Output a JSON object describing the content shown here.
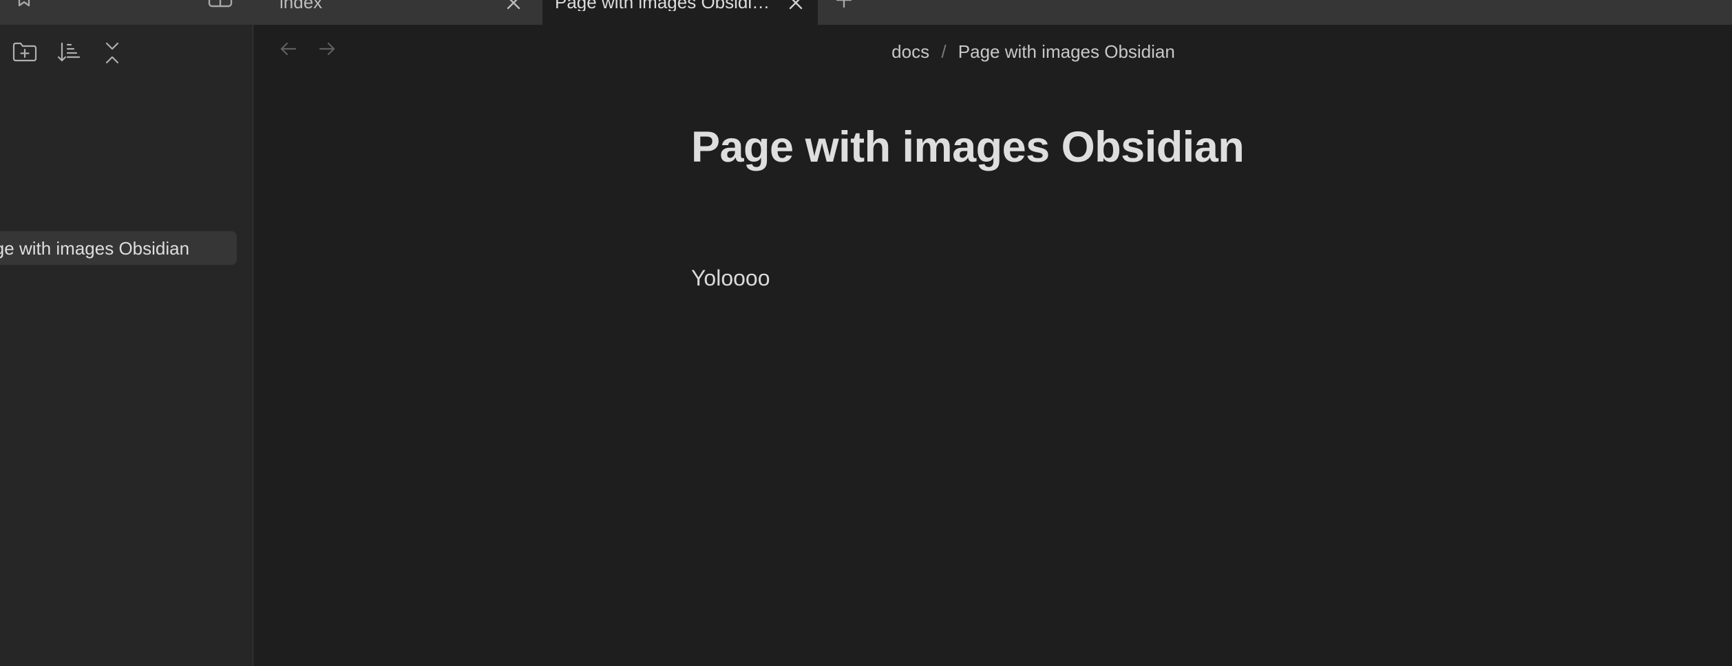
{
  "tabbar": {
    "tabs": [
      {
        "title": "index",
        "active": false
      },
      {
        "title": "Page with images Obsidi…",
        "active": true
      }
    ],
    "new_tab_icon": "plus-icon",
    "bookmark_icon": "bookmark-icon",
    "layout_icon": "sidebar-layout-icon"
  },
  "sidebar": {
    "toolbar_icons": [
      "new-folder-icon",
      "sort-icon",
      "collapse-all-icon"
    ],
    "files": [
      {
        "label": "Page with images Obsidian",
        "selected": true
      }
    ]
  },
  "main": {
    "breadcrumb": {
      "folder": "docs",
      "separator": "/",
      "page": "Page with images Obsidian"
    },
    "title": "Page with images Obsidian",
    "body": "Yoloooo"
  },
  "theme": {
    "background": "#1e1e1e",
    "sidebar_background": "#262626",
    "tabbar_background": "#363636",
    "text": "#dadada"
  }
}
